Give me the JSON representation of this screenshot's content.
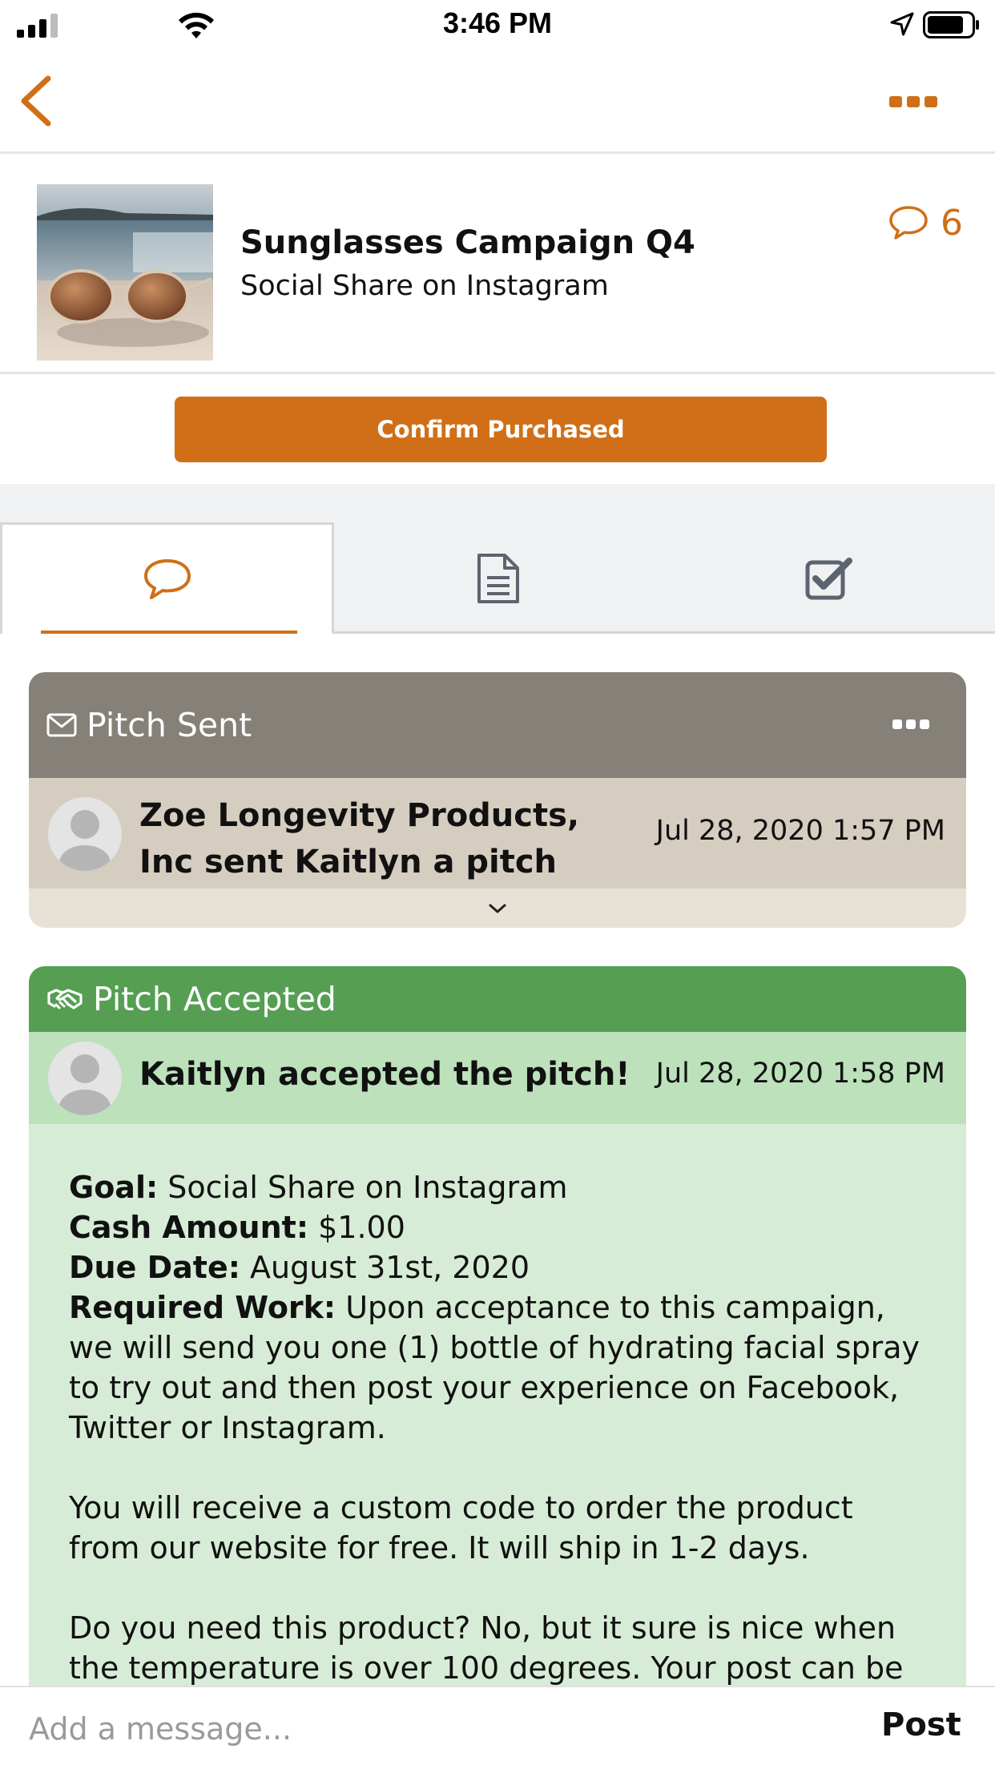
{
  "status_bar": {
    "time": "3:46 PM",
    "icons": [
      "signal-icon",
      "wifi-icon",
      "location-arrow-icon",
      "battery-icon"
    ]
  },
  "nav": {
    "back_icon": "chevron-left-icon",
    "more_icon": "ellipsis-icon"
  },
  "campaign": {
    "title": "Sunglasses Campaign Q4",
    "subtitle": "Social Share on Instagram",
    "comment_count": "6",
    "thumbnail_icon": "sunglasses-photo"
  },
  "confirm_button": "Confirm Purchased",
  "tabs": [
    {
      "icon": "chat-bubble-icon",
      "active": true
    },
    {
      "icon": "document-icon",
      "active": false
    },
    {
      "icon": "checkbox-icon",
      "active": false
    }
  ],
  "pitch_sent": {
    "header": "Pitch Sent",
    "message": "Zoe Longevity Products, Inc sent Kaitlyn a pitch",
    "timestamp": "Jul 28, 2020 1:57 PM"
  },
  "pitch_accepted": {
    "header": "Pitch Accepted",
    "message": "Kaitlyn accepted the pitch!",
    "timestamp": "Jul 28, 2020 1:58 PM",
    "details": {
      "goal_label": "Goal:",
      "goal": "Social Share on Instagram",
      "cash_label": "Cash Amount:",
      "cash": "$1.00",
      "due_label": "Due Date:",
      "due": "August 31st, 2020",
      "work_label": "Required Work:",
      "work": "Upon acceptance to this campaign, we will send you one (1) bottle of hydrating facial spray to try out and then post your experience on Facebook, Twitter or Instagram.",
      "para2": "You will receive a custom code to order the product from our website for free. It will ship in 1-2 days.",
      "para3": "Do you need this product? No, but it sure is nice when the temperature is over 100 degrees. Your post can be"
    }
  },
  "message_bar": {
    "placeholder": "Add a message...",
    "post_label": "Post"
  },
  "colors": {
    "accent": "#d06f17",
    "sent_header": "#858078",
    "accepted_header": "#559e52"
  }
}
